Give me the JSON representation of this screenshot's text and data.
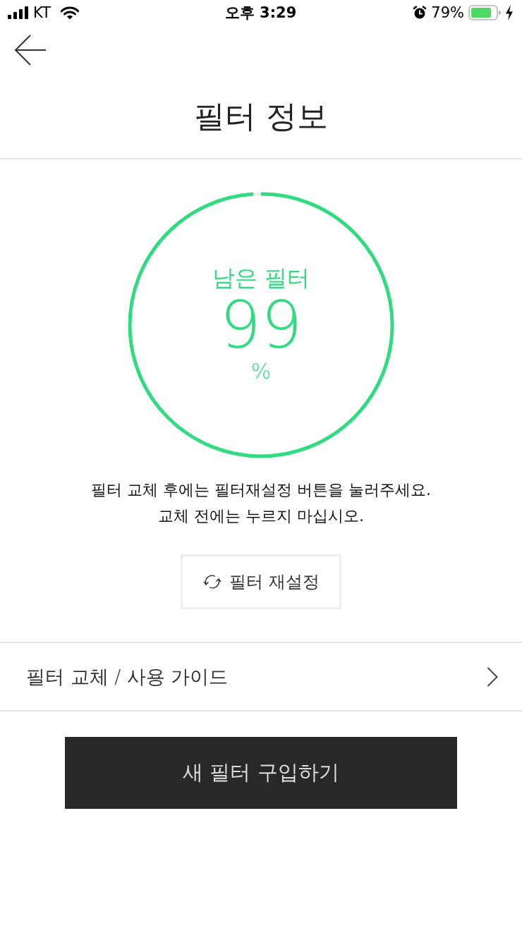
{
  "status_bar": {
    "carrier": "KT",
    "time": "오후 3:29",
    "battery": "79%"
  },
  "header": {
    "title": "필터 정보"
  },
  "filter_meter": {
    "label": "남은 필터",
    "value": "99",
    "unit": "%",
    "level": 0.99
  },
  "notice": "필터 교체 후에는 필터재설정 버튼을 눌러주세요.\n교체 전에는 누르지 마십시오.",
  "reset_button": {
    "label": "필터 재설정"
  },
  "guide_row": {
    "label": "필터 교체 / 사용 가이드"
  },
  "buy_button": {
    "label": "새 필터 구입하기"
  }
}
